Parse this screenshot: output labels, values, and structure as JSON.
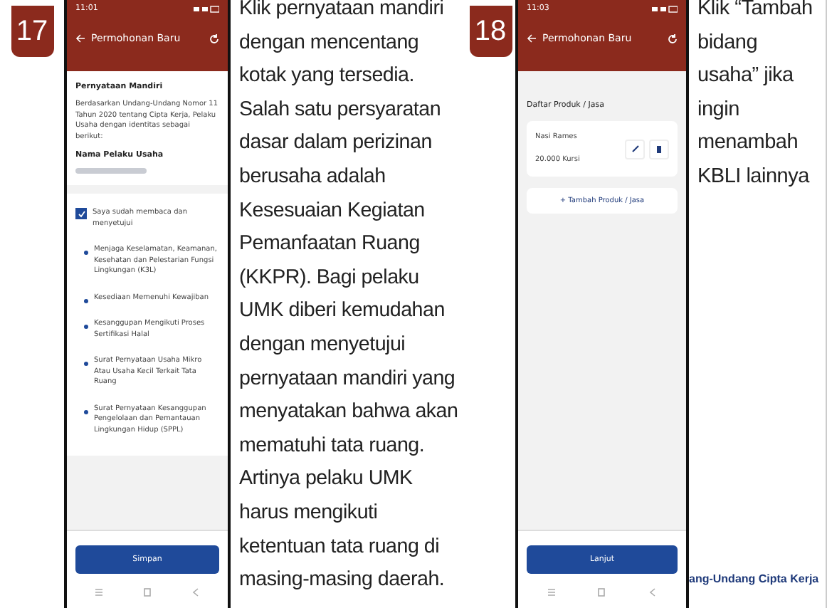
{
  "steps": [
    {
      "number": "17",
      "phone": {
        "kind": "statement",
        "status_time": "11:01",
        "title": "Permohonan Baru",
        "section_title": "Pernyataan Mandiri",
        "intro": "Berdasarkan Undang-Undang Nomor 11 Tahun 2020 tentang Cipta Kerja, Pelaku Usaha dengan identitas sebagai berikut:",
        "field_label": "Nama Pelaku Usaha",
        "agree": {
          "label": "Saya sudah membaca dan menyetujui",
          "checked": true
        },
        "items": [
          "Menjaga Keselamatan, Keamanan, Kesehatan dan Pelestarian Fungsi Lingkungan (K3L)",
          "Kesediaan Memenuhi Kewajiban",
          "Kesanggupan Mengikuti Proses Sertifikasi Halal",
          "Surat Pernyataan Usaha Mikro Atau Usaha Kecil Terkait Tata Ruang",
          "Surat Pernyataan Kesanggupan Pengelolaan dan Pemantauan Lingkungan Hidup (SPPL)"
        ],
        "button": "Simpan"
      },
      "caption": "Klik pernyataan mandiri dengan mencentang kotak yang tersedia. Salah satu persyaratan dasar dalam perizinan berusaha adalah Kesesuaian Kegiatan Pemanfaatan Ruang (KKPR). Bagi pelaku UMK diberi kemudahan dengan menyetujui pernyataan mandiri yang menyatakan bahwa akan mematuhi tata ruang. Artinya pelaku UMK harus mengikuti ketentuan tata ruang di masing-masing daerah."
    },
    {
      "number": "18",
      "phone": {
        "kind": "products",
        "status_time": "11:03",
        "title": "Permohonan Baru",
        "section_title": "Daftar Produk / Jasa",
        "products": [
          {
            "name": "Nasi Rames",
            "detail": "20.000 Kursi"
          }
        ],
        "add_button": "+ Tambah Produk / Jasa",
        "button": "Lanjut"
      },
      "caption": "Klik “Tambah bidang usaha” jika ingin menambah KBLI lainnya"
    }
  ],
  "footer": "ang-Undang Cipta Kerja"
}
